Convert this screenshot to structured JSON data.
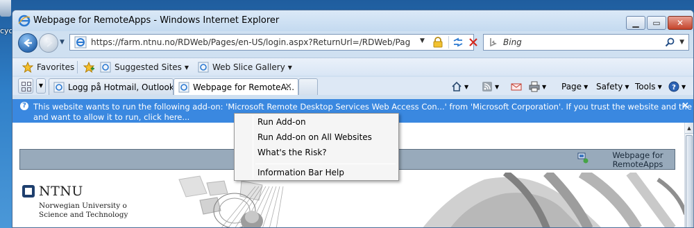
{
  "desktop": {
    "icon_label": "cyc"
  },
  "window": {
    "title": "Webpage for RemoteApps - Windows Internet Explorer"
  },
  "address_bar": {
    "url": "https://farm.ntnu.no/RDWeb/Pages/en-US/login.aspx?ReturnUrl=/RDWeb/Pages/en-US/"
  },
  "search": {
    "placeholder": "Bing"
  },
  "favorites_bar": {
    "favorites_label": "Favorites",
    "items": [
      {
        "label": "Suggested Sites"
      },
      {
        "label": "Web Slice Gallery"
      }
    ]
  },
  "tabs": [
    {
      "label": "Logg på Hotmail, Outlook,...",
      "active": false
    },
    {
      "label": "Webpage for RemoteA...",
      "active": true
    }
  ],
  "command_bar": {
    "page_label": "Page",
    "safety_label": "Safety",
    "tools_label": "Tools"
  },
  "info_bar": {
    "line1": "This website wants to run the following add-on: 'Microsoft Remote Desktop Services Web Access Con...' from 'Microsoft Corporation'. If you trust the website and the add-on",
    "line2": "and want to allow it to run, click here...",
    "close": "×"
  },
  "page": {
    "header_title": "Webpage for RemoteApps",
    "logo_name": "NTNU",
    "logo_sub_line1": "Norwegian University o",
    "logo_sub_line2": "Science and Technology"
  },
  "context_menu": {
    "items": [
      {
        "label": "Run Add-on"
      },
      {
        "label": "Run Add-on on All Websites"
      },
      {
        "label": "What's the Risk?"
      },
      {
        "label": "Information Bar Help"
      }
    ]
  },
  "colors": {
    "info_bar": "#3a88e0",
    "page_header": "#98aabb",
    "desktop": "#2f7fc8"
  }
}
